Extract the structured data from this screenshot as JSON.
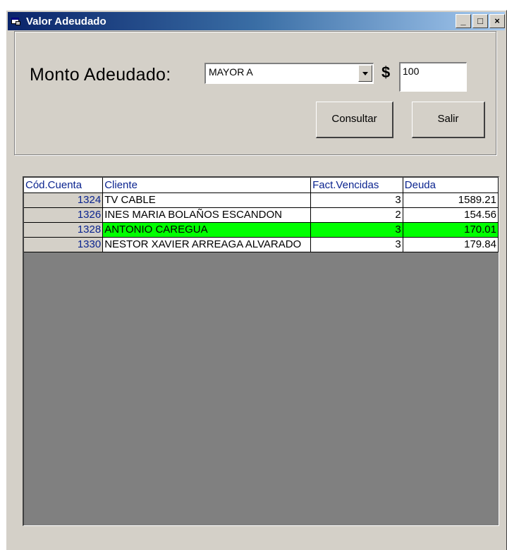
{
  "window": {
    "title": "Valor Adeudado",
    "minimize_label": "_",
    "maximize_label": "□",
    "close_label": "×"
  },
  "filter": {
    "label": "Monto Adeudado:",
    "operator_value": "MAYOR A",
    "currency_symbol": "$",
    "amount_value": "100"
  },
  "buttons": {
    "consultar": "Consultar",
    "salir": "Salir"
  },
  "grid": {
    "columns": [
      "Cód.Cuenta",
      "Cliente",
      "Fact.Vencidas",
      "Deuda"
    ],
    "rows": [
      {
        "cuenta": "1324",
        "cliente": "TV CABLE",
        "vencidas": "3",
        "deuda": "1589.21"
      },
      {
        "cuenta": "1326",
        "cliente": "INES MARIA BOLAÑOS ESCANDON",
        "vencidas": "2",
        "deuda": "154.56"
      },
      {
        "cuenta": "1328",
        "cliente": "ANTONIO CAREGUA",
        "vencidas": "3",
        "deuda": "170.01"
      },
      {
        "cuenta": "1330",
        "cliente": "NESTOR XAVIER ARREAGA ALVARADO",
        "vencidas": "3",
        "deuda": "179.84"
      }
    ],
    "selected_row_index": 2,
    "selected_row_color": "#00ff00"
  }
}
